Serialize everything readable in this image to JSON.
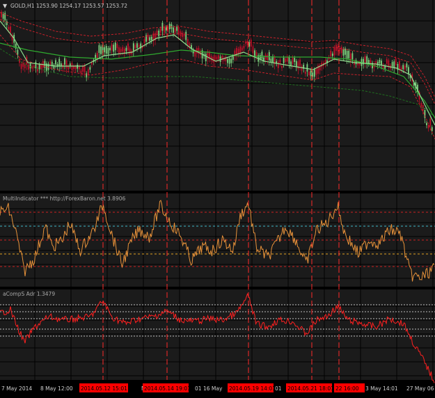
{
  "colors": {
    "background": "#1b1b1b",
    "separator": "#000000",
    "grid": "#000000",
    "candle_up": "#7fd37f",
    "candle_down": "#c0102a",
    "ma_fast": "#8fe08f",
    "ma_slow": "#2faa2f",
    "band": "#c8202a",
    "band_lower_green": "#1f6f1f",
    "vline": "#ff2a2a",
    "osc_line": "#e8923a",
    "osc_level_red": "#cc2222",
    "osc_level_cyan": "#3fb8c8",
    "osc_level_orange": "#e0a020",
    "adx_line": "#ff2020",
    "adx_levels": "#bfbfbf",
    "label_text": "#d0d0d0",
    "date_highlight_bg": "#ff0000",
    "date_highlight_text": "#000000"
  },
  "main_panel": {
    "indicator_icon": "triangle-down-icon",
    "title": "GOLD,H1  1253.90 1254.17 1253.57 1253.72"
  },
  "oscillator_panel": {
    "title": "MultiIndicator *** http://ForexBaron.net 3.8906"
  },
  "adx_panel": {
    "title": "aCompS Adr 1.3479"
  },
  "time_axis": {
    "labels": [
      {
        "text": "7 May 2014",
        "highlight": false
      },
      {
        "text": "8 May 12:00",
        "highlight": false
      },
      {
        "text": "2014.05.12 15:01",
        "highlight": true
      },
      {
        "text": "Ma",
        "highlight": false
      },
      {
        "text": "2014.05.14 19:01",
        "highlight": true
      },
      {
        "text": "01",
        "highlight": false
      },
      {
        "text": "16 May",
        "highlight": false
      },
      {
        "text": "2014.05.19 14:01",
        "highlight": true
      },
      {
        "text": "01",
        "highlight": false
      },
      {
        "text": "2014.05.21 18:01",
        "highlight": true
      },
      {
        "text": "22 16:00",
        "highlight": true
      },
      {
        "text": "3 May 14:01",
        "highlight": false
      },
      {
        "text": "27 May 06",
        "highlight": false
      }
    ]
  }
}
